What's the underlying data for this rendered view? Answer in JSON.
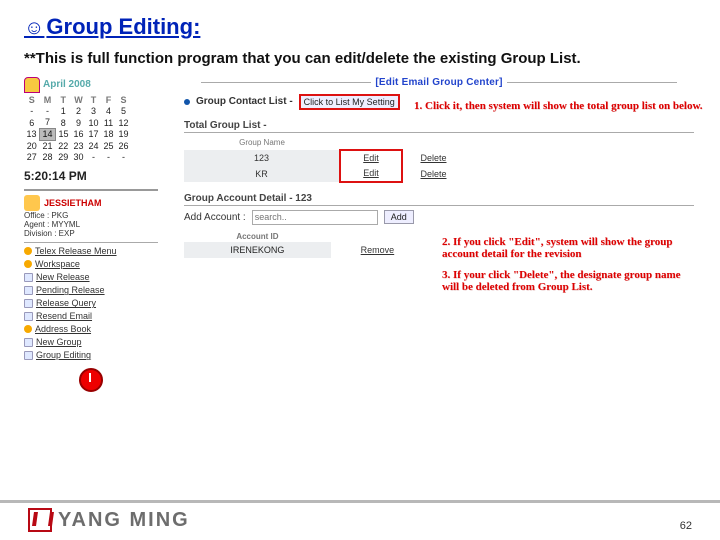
{
  "title": "Group Editing:",
  "smile": "☺",
  "subtitle": "**This is full function program that you can edit/delete the existing Group List.",
  "header_center": "[Edit Email Group Center]",
  "calendar": {
    "month": "April 2008",
    "dow": [
      "S",
      "M",
      "T",
      "W",
      "T",
      "F",
      "S"
    ],
    "rows": [
      [
        "-",
        "-",
        "1",
        "2",
        "3",
        "4",
        "5"
      ],
      [
        "6",
        "7",
        "8",
        "9",
        "10",
        "11",
        "12"
      ],
      [
        "13",
        "14",
        "15",
        "16",
        "17",
        "18",
        "19"
      ],
      [
        "20",
        "21",
        "22",
        "23",
        "24",
        "25",
        "26"
      ],
      [
        "27",
        "28",
        "29",
        "30",
        "-",
        "-",
        "-"
      ]
    ],
    "today": "14"
  },
  "clock": "5:20:14 PM",
  "user": {
    "name": "JESSIETHAM",
    "office": "Office : PKG",
    "agent": "Agent : MYYML",
    "division": "Division : EXP"
  },
  "sidemenu": {
    "items": [
      {
        "label": "Telex Release Menu",
        "sub": false
      },
      {
        "label": "Workspace",
        "sub": false
      },
      {
        "label": "New Release",
        "sub": true
      },
      {
        "label": "Pending Release",
        "sub": true
      },
      {
        "label": "Release Query",
        "sub": true
      },
      {
        "label": "Resend Email",
        "sub": true
      },
      {
        "label": "Address Book",
        "sub": false
      },
      {
        "label": "New Group",
        "sub": true
      },
      {
        "label": "Group Editing",
        "sub": true
      }
    ]
  },
  "contact": {
    "label": "Group Contact List -",
    "btn": "Click to List My Setting"
  },
  "note1": "1. Click it, then system will show the total group list on below.",
  "groups": {
    "title": "Total Group List -",
    "headers": [
      "Group Name",
      "",
      ""
    ],
    "rows": [
      {
        "name": "123",
        "edit": "Edit",
        "del": "Delete"
      },
      {
        "name": "KR",
        "edit": "Edit",
        "del": "Delete"
      }
    ]
  },
  "detail": {
    "title": "Group Account Detail - 123",
    "addlabel": "Add Account :",
    "searchPlaceholder": "search..",
    "addBtn": "Add",
    "headers": [
      "Account ID",
      ""
    ],
    "row": {
      "id": "IRENEKONG",
      "remove": "Remove"
    }
  },
  "note2": "2. If you click \"Edit\", system will show the group account detail for the revision",
  "note3": "3. If your click \"Delete\", the designate group name will be deleted from Group List.",
  "footer": {
    "company": "YANG MING",
    "page": "62"
  }
}
